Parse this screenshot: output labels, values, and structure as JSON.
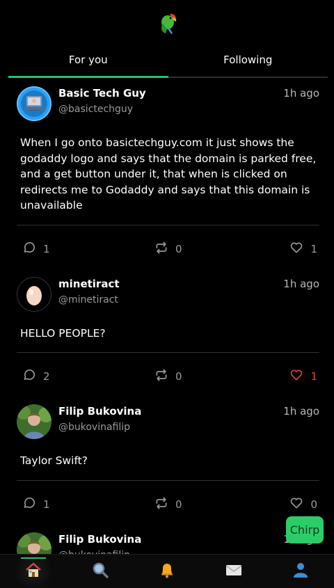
{
  "header": {
    "logo_icon": "parrot-icon"
  },
  "tabs": [
    {
      "label": "For you",
      "active": true
    },
    {
      "label": "Following",
      "active": false
    }
  ],
  "posts": [
    {
      "name": "Basic Tech Guy",
      "handle": "@basictechguy",
      "time": "1h ago",
      "text": "When I go onto basictechguy.com it just shows the godaddy logo and says that the domain is parked free, and a get button under it, that when is clicked on redirects me to Godaddy and says that this domain is unavailable",
      "comments": "1",
      "rechirps": "0",
      "likes": "1",
      "liked": false,
      "avatar_icon": "laptop-guy-avatar"
    },
    {
      "name": "minetiract",
      "handle": "@minetiract",
      "time": "1h ago",
      "text": "HELLO PEOPLE?",
      "comments": "2",
      "rechirps": "0",
      "likes": "1",
      "liked": true,
      "avatar_icon": "egg-avatar"
    },
    {
      "name": "Filip Bukovina",
      "handle": "@bukovinafilip",
      "time": "1h ago",
      "text": "Taylor Swift?",
      "comments": "1",
      "rechirps": "0",
      "likes": "0",
      "liked": false,
      "avatar_icon": "photo-avatar"
    },
    {
      "name": "Filip Bukovina",
      "handle": "@bukovinafilip",
      "time": "1h ago",
      "avatar_icon": "photo-avatar"
    }
  ],
  "compose": {
    "label": "Chirp"
  },
  "nav": [
    {
      "icon": "home-icon",
      "active": true
    },
    {
      "icon": "search-icon",
      "active": false
    },
    {
      "icon": "bell-icon",
      "active": false
    },
    {
      "icon": "mail-icon",
      "active": false
    },
    {
      "icon": "profile-icon",
      "active": false
    }
  ],
  "colors": {
    "accent": "#27c268",
    "like": "#e0443b",
    "chirp_button": "#2ccd68"
  }
}
